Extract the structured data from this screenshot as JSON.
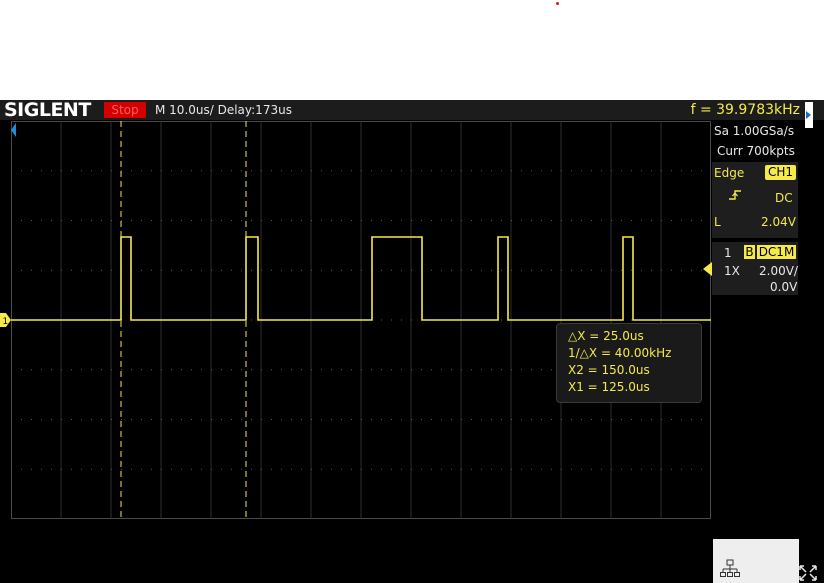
{
  "header": {
    "logo": "SIGLENT",
    "run_status": "Stop",
    "timebase": "M 10.0us/  Delay:173us",
    "frequency": "f = 39.9783kHz"
  },
  "acquisition": {
    "sample_rate": "Sa 1.00GSa/s",
    "memory_depth": "Curr 700kpts"
  },
  "trigger": {
    "type": "Edge",
    "source": "CH1",
    "slope_icon": "rising-edge-icon",
    "coupling": "DC",
    "level_label": "L",
    "level": "2.04V"
  },
  "channel1": {
    "number": "1",
    "bandwidth_limit": "B",
    "coupling": "DC1M",
    "probe": "1X",
    "scale": "2.00V/",
    "offset": "0.0V",
    "ground_marker": "1",
    "color": "#f5e94c"
  },
  "cursors": {
    "delta_x": "△X = 25.0us",
    "inverse_delta_x": "1/△X = 40.00kHz",
    "x2": "X2 = 150.0us",
    "x1": "X1 = 125.0us",
    "x1_time_us": 125,
    "x2_time_us": 150
  },
  "icons": {
    "network": "network-icon",
    "fullscreen": "fullscreen-icon",
    "trigger_position": "trigger-position-icon"
  },
  "colors": {
    "trace": "#f5e94c",
    "stop_badge": "#d40000",
    "trigger_marker": "#1a8fd6"
  }
}
